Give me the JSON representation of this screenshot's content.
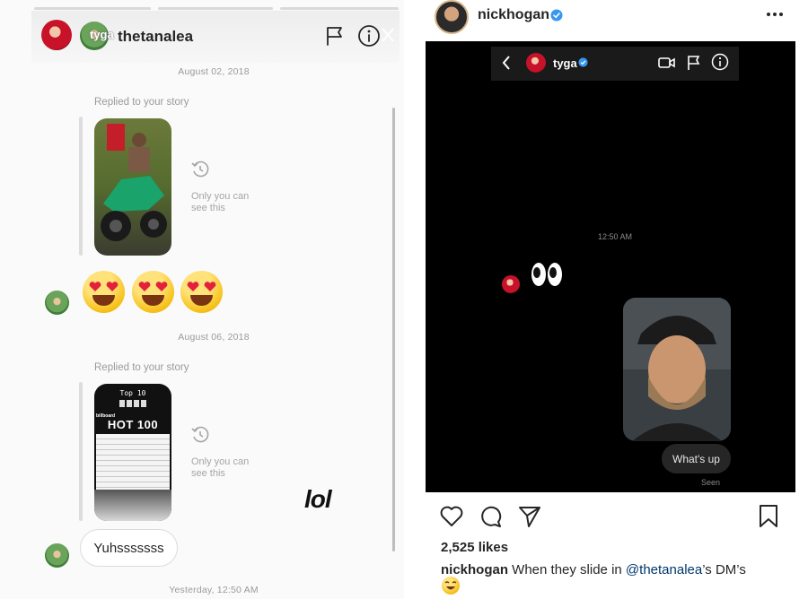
{
  "left_panel": {
    "header": {
      "handle_overlay": "tyga",
      "handle": "thetanalea"
    },
    "thread": [
      {
        "date": "August 02, 2018",
        "replied_label": "Replied to your story",
        "only_you_line1": "Only you can",
        "only_you_line2": "see this"
      },
      {
        "date": "August 06, 2018",
        "replied_label": "Replied to your story",
        "only_you_line1": "Only you can",
        "only_you_line2": "see this",
        "story_chart_title": "Top 10",
        "story_billboard": "billboard",
        "story_hot100": "HOT 100"
      }
    ],
    "emoji_reply": [
      "heart-eyes",
      "heart-eyes",
      "heart-eyes"
    ],
    "message_out": "Yuhsssssss",
    "last_timestamp": "Yesterday, 12:50 AM",
    "overlay_text": "lol"
  },
  "right_panel": {
    "post_header": {
      "username": "nickhogan",
      "verified": true,
      "more_icon": "ellipsis-icon"
    },
    "inner_screenshot": {
      "handle": "tyga",
      "timestamp": "12:50 AM",
      "eyes_emoji": "eyes",
      "bubble_text": "What's up",
      "seen_label": "Seen"
    },
    "likes": "2,525 likes",
    "caption": {
      "username": "nickhogan",
      "text_before": " When they slide in ",
      "mention": "@thetanalea",
      "text_after": "’s DM’s",
      "emoji": "rofl"
    }
  },
  "colors": {
    "verified_blue": "#3897f0",
    "mention_blue": "#00376b",
    "text_dark": "#262626",
    "text_muted": "#9a9a9a"
  }
}
